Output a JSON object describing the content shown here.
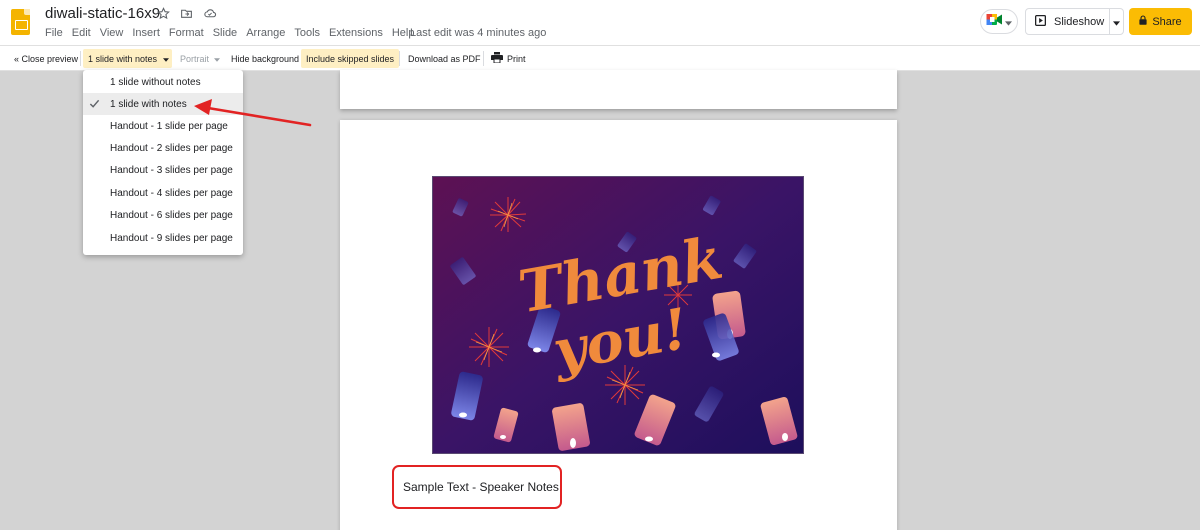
{
  "app": {
    "doc_title": "diwali-static-16x9",
    "menu": [
      "File",
      "Edit",
      "View",
      "Insert",
      "Format",
      "Slide",
      "Arrange",
      "Tools",
      "Extensions",
      "Help"
    ],
    "last_edit": "Last edit was 4 minutes ago",
    "slideshow_label": "Slideshow",
    "share_label": "Share"
  },
  "toolbar": {
    "close_preview": "« Close preview",
    "layout_select": "1 slide with notes",
    "orientation": "Portrait",
    "hide_background": "Hide background",
    "include_skipped": "Include skipped slides",
    "download_pdf": "Download as PDF",
    "print": "Print"
  },
  "dropdown": {
    "selected_index": 1,
    "items": [
      "1 slide without notes",
      "1 slide with notes",
      "Handout - 1 slide per page",
      "Handout - 2 slides per page",
      "Handout - 3 slides per page",
      "Handout - 4 slides per page",
      "Handout - 6 slides per page",
      "Handout - 9 slides per page"
    ]
  },
  "slide": {
    "image_text_line1": "Thank",
    "image_text_line2": "you!",
    "speaker_notes": "Sample Text - Speaker Notes"
  },
  "colors": {
    "accent_yellow": "#fbbc04",
    "highlight": "#feefc3",
    "annotation_red": "#e22323",
    "canvas_gray": "#d3d3d3",
    "thankyou_orange": "#f08a3c"
  },
  "icons": {
    "star": "star-icon",
    "folder": "move-to-folder-icon",
    "cloud": "cloud-saved-icon",
    "meet": "google-meet-icon",
    "play": "slideshow-play-icon",
    "lock": "lock-icon",
    "printer": "printer-icon",
    "check": "checkmark-icon"
  }
}
